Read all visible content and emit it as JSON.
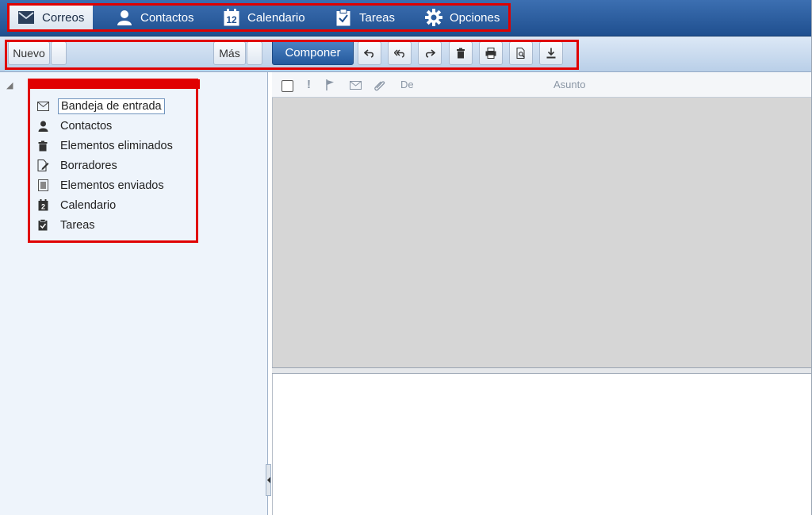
{
  "tabs": [
    {
      "label": "Correos",
      "icon": "envelope-icon"
    },
    {
      "label": "Contactos",
      "icon": "person-icon"
    },
    {
      "label": "Calendario",
      "icon": "calendar-icon"
    },
    {
      "label": "Tareas",
      "icon": "clipboard-check-icon"
    },
    {
      "label": "Opciones",
      "icon": "gear-icon"
    }
  ],
  "toolbar": {
    "new_label": "Nuevo",
    "more_label": "Más",
    "compose_label": "Componer",
    "icon_buttons": [
      "reply-icon",
      "reply-all-icon",
      "forward-icon",
      "trash-icon",
      "print-icon",
      "preview-icon",
      "download-icon"
    ]
  },
  "folders": [
    {
      "label": "Bandeja de entrada",
      "icon": "envelope-icon",
      "selected": true
    },
    {
      "label": "Contactos",
      "icon": "person-icon"
    },
    {
      "label": "Elementos eliminados",
      "icon": "trash-icon"
    },
    {
      "label": "Borradores",
      "icon": "draft-icon"
    },
    {
      "label": "Elementos enviados",
      "icon": "sent-icon"
    },
    {
      "label": "Calendario",
      "icon": "calendar-icon"
    },
    {
      "label": "Tareas",
      "icon": "clipboard-check-icon"
    }
  ],
  "list_header": {
    "importance": "!",
    "from": "De",
    "subject": "Asunto"
  },
  "calendar_day": "12",
  "folder_calendar_day": "2",
  "colors": {
    "topbar": "#2a5c9e",
    "toolbar": "#c9dbef",
    "highlight": "#e00000",
    "compose": "#2f67ad",
    "left_pane": "#eef4fb",
    "list_area": "#d6d6d6"
  }
}
